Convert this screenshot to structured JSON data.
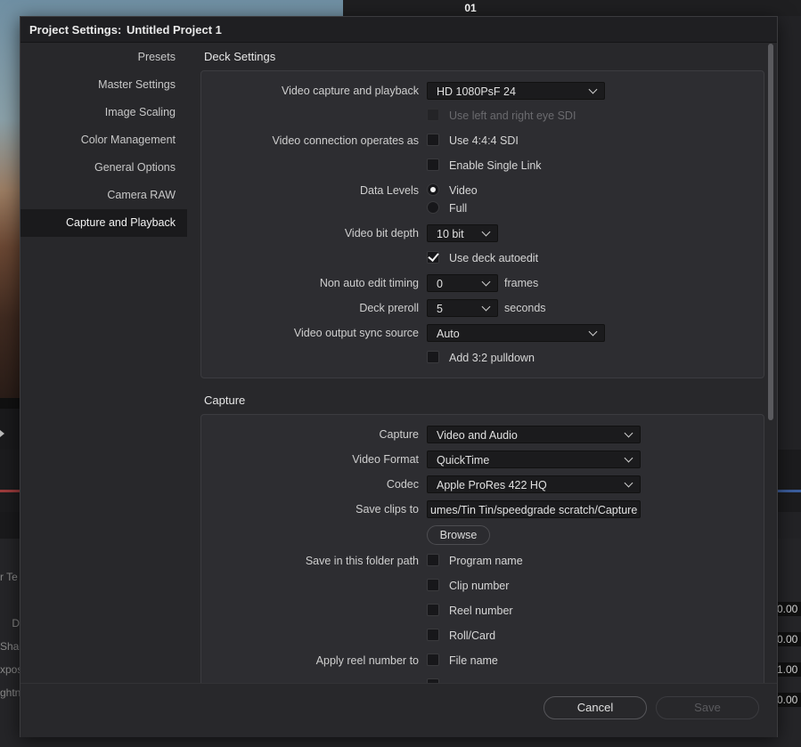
{
  "background": {
    "timecode": "01",
    "left_labels": [
      "r Te",
      "D",
      "Shac",
      "xpos",
      "ghtn"
    ],
    "right_values": [
      "0.00",
      "0.00",
      "1.00",
      "0.00"
    ]
  },
  "dialog": {
    "title_prefix": "Project Settings:",
    "title_project": "Untitled Project 1"
  },
  "sidebar": {
    "items": [
      {
        "label": "Presets"
      },
      {
        "label": "Master Settings"
      },
      {
        "label": "Image Scaling"
      },
      {
        "label": "Color Management"
      },
      {
        "label": "General Options"
      },
      {
        "label": "Camera RAW"
      },
      {
        "label": "Capture and Playback",
        "active": true
      }
    ]
  },
  "deck": {
    "title": "Deck Settings",
    "video_capture_label": "Video capture and playback",
    "video_capture_value": "HD 1080PsF 24",
    "eye_sdi_label": "Use left and right eye SDI",
    "connection_label": "Video connection operates as",
    "sdi444_label": "Use 4:4:4 SDI",
    "single_link_label": "Enable Single Link",
    "data_levels_label": "Data Levels",
    "level_video": "Video",
    "level_full": "Full",
    "bit_depth_label": "Video bit depth",
    "bit_depth_value": "10 bit",
    "autoedit_label": "Use deck autoedit",
    "non_auto_label": "Non auto edit timing",
    "non_auto_value": "0",
    "non_auto_unit": "frames",
    "preroll_label": "Deck preroll",
    "preroll_value": "5",
    "preroll_unit": "seconds",
    "sync_label": "Video output sync source",
    "sync_value": "Auto",
    "pulldown_label": "Add 3:2 pulldown"
  },
  "capture": {
    "title": "Capture",
    "capture_label": "Capture",
    "capture_value": "Video and Audio",
    "format_label": "Video Format",
    "format_value": "QuickTime",
    "codec_label": "Codec",
    "codec_value": "Apple ProRes 422 HQ",
    "save_label": "Save clips to",
    "save_path": "umes/Tin Tin/speedgrade scratch/Capture",
    "browse_label": "Browse",
    "folder_label": "Save in this folder path",
    "program_name": "Program name",
    "clip_number": "Clip number",
    "reel_number": "Reel number",
    "roll_card": "Roll/Card",
    "apply_reel_label": "Apply reel number to",
    "file_name": "File name"
  },
  "footer": {
    "cancel_label": "Cancel",
    "save_label": "Save"
  }
}
